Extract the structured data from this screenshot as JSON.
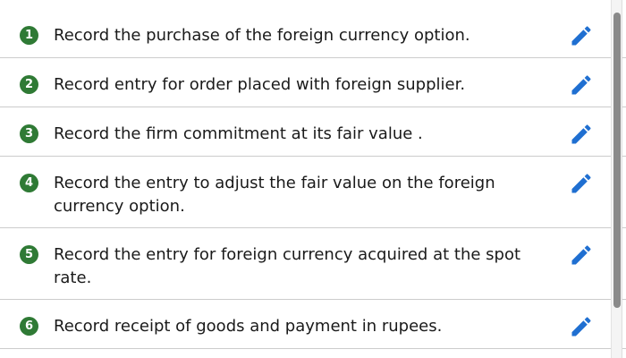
{
  "steps": [
    {
      "number": "1",
      "text": "Record the purchase of the foreign currency option."
    },
    {
      "number": "2",
      "text": "Record entry for order placed with foreign supplier."
    },
    {
      "number": "3",
      "text": "Record the firm commitment at its fair value ."
    },
    {
      "number": "4",
      "text": "Record the entry to adjust the fair value on the foreign currency option."
    },
    {
      "number": "5",
      "text": "Record the entry for foreign currency acquired at the spot rate."
    },
    {
      "number": "6",
      "text": "Record receipt of goods and payment in rupees."
    }
  ],
  "icons": {
    "edit": "pencil-icon"
  },
  "colors": {
    "badge": "#2f7a35",
    "edit_icon": "#1f6fd1",
    "divider": "#cccccc"
  }
}
